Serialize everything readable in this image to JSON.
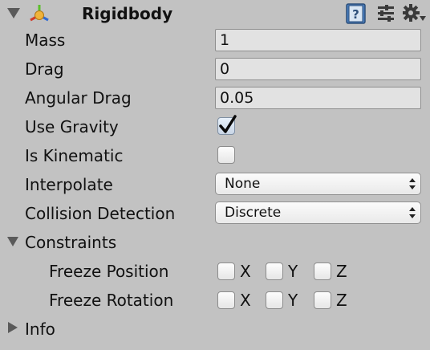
{
  "component": {
    "title": "Rigidbody",
    "icon": "rigidbody-icon",
    "header_icons": [
      "help-book-icon",
      "preset-sliders-icon",
      "settings-gear-icon"
    ],
    "expanded": true
  },
  "fields": {
    "mass": {
      "label": "Mass",
      "value": "1"
    },
    "drag": {
      "label": "Drag",
      "value": "0"
    },
    "angular_drag": {
      "label": "Angular Drag",
      "value": "0.05"
    },
    "use_gravity": {
      "label": "Use Gravity",
      "checked": true
    },
    "is_kinematic": {
      "label": "Is Kinematic",
      "checked": false
    },
    "interpolate": {
      "label": "Interpolate",
      "selected": "None"
    },
    "collision_detection": {
      "label": "Collision Detection",
      "selected": "Discrete"
    }
  },
  "constraints": {
    "label": "Constraints",
    "expanded": true,
    "freeze_position": {
      "label": "Freeze Position",
      "x": "X",
      "y": "Y",
      "z": "Z",
      "x_checked": false,
      "y_checked": false,
      "z_checked": false
    },
    "freeze_rotation": {
      "label": "Freeze Rotation",
      "x": "X",
      "y": "Y",
      "z": "Z",
      "x_checked": false,
      "y_checked": false,
      "z_checked": false
    }
  },
  "info": {
    "label": "Info",
    "expanded": false
  },
  "colors": {
    "background": "#c2c2c2",
    "field": "#e2e2e2",
    "checkmark": "#0a0a0a"
  }
}
